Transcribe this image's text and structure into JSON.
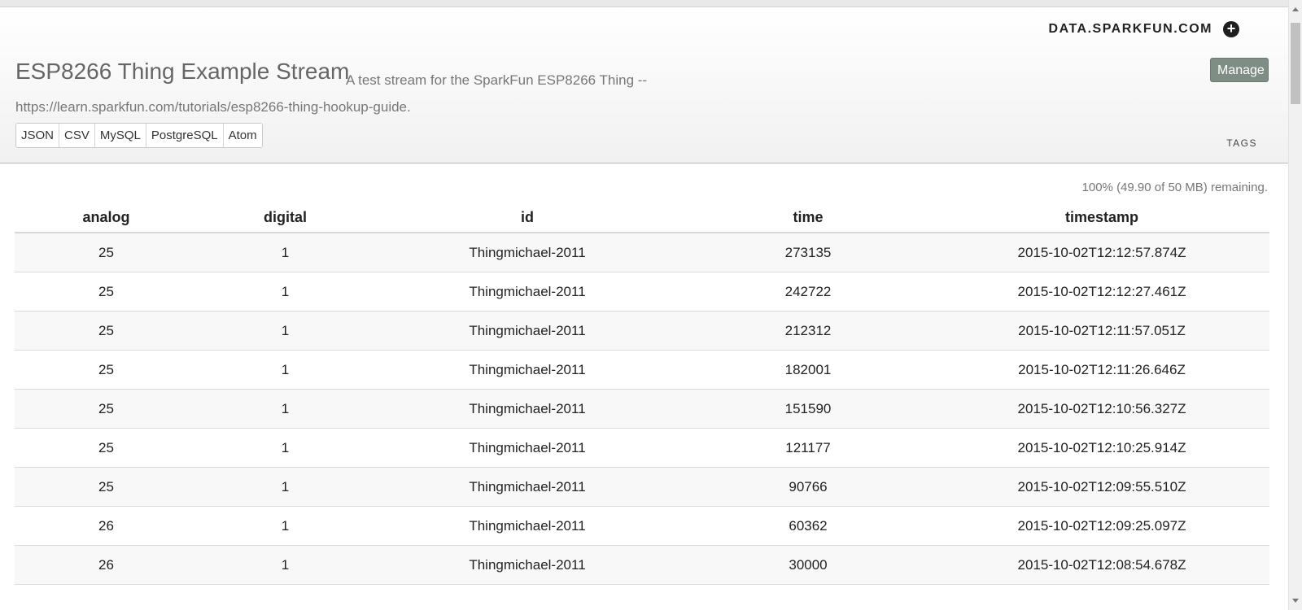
{
  "brand": {
    "name": "DATA.SPARKFUN.COM",
    "icon": "plus-circle-icon"
  },
  "stream": {
    "title": "ESP8266 Thing Example Stream",
    "description_line1": "A test stream for the SparkFun ESP8266 Thing --",
    "description_line2": "https://learn.sparkfun.com/tutorials/esp8266-thing-hookup-guide."
  },
  "actions": {
    "manage_label": "Manage"
  },
  "formats": [
    "JSON",
    "CSV",
    "MySQL",
    "PostgreSQL",
    "Atom"
  ],
  "tags_label": "TAGS",
  "storage": {
    "remaining_text": "100% (49.90 of 50 MB) remaining."
  },
  "table": {
    "columns": [
      "analog",
      "digital",
      "id",
      "time",
      "timestamp"
    ],
    "rows": [
      [
        "25",
        "1",
        "Thingmichael-2011",
        "273135",
        "2015-10-02T12:12:57.874Z"
      ],
      [
        "25",
        "1",
        "Thingmichael-2011",
        "242722",
        "2015-10-02T12:12:27.461Z"
      ],
      [
        "25",
        "1",
        "Thingmichael-2011",
        "212312",
        "2015-10-02T12:11:57.051Z"
      ],
      [
        "25",
        "1",
        "Thingmichael-2011",
        "182001",
        "2015-10-02T12:11:26.646Z"
      ],
      [
        "25",
        "1",
        "Thingmichael-2011",
        "151590",
        "2015-10-02T12:10:56.327Z"
      ],
      [
        "25",
        "1",
        "Thingmichael-2011",
        "121177",
        "2015-10-02T12:10:25.914Z"
      ],
      [
        "25",
        "1",
        "Thingmichael-2011",
        "90766",
        "2015-10-02T12:09:55.510Z"
      ],
      [
        "26",
        "1",
        "Thingmichael-2011",
        "60362",
        "2015-10-02T12:09:25.097Z"
      ],
      [
        "26",
        "1",
        "Thingmichael-2011",
        "30000",
        "2015-10-02T12:08:54.678Z"
      ]
    ]
  },
  "colors": {
    "manage_button": "#7e8e85",
    "text": "#222222",
    "muted_text": "#777777"
  }
}
